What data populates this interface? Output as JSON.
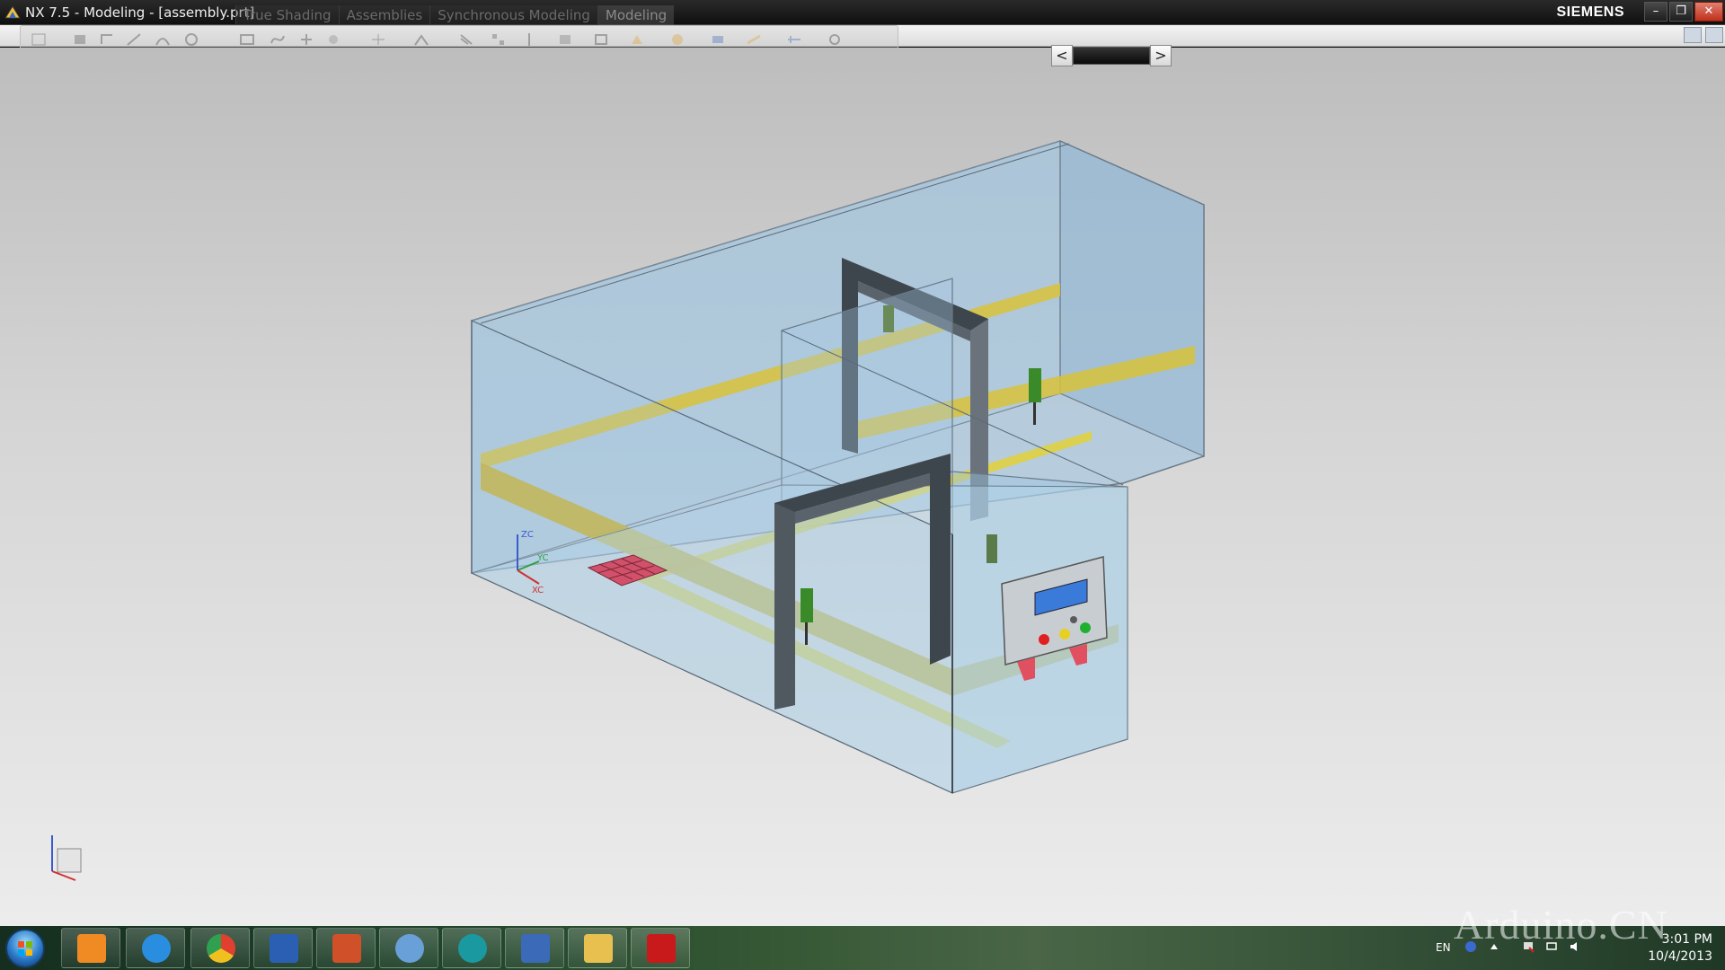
{
  "window": {
    "title": "NX 7.5 - Modeling - [assembly.prt]",
    "brand": "SIEMENS",
    "minimize_label": "–",
    "maximize_label": "❐",
    "close_label": "✕"
  },
  "ribbon": {
    "tabs": [
      {
        "label": "True Shading"
      },
      {
        "label": "Assemblies"
      },
      {
        "label": "Synchronous Modeling"
      },
      {
        "label": "Modeling"
      }
    ]
  },
  "graphics": {
    "background_top": "#bdbdbd",
    "background_bottom": "#ececec",
    "glass_color": "#9cc3e0",
    "rail_color": "#d8c23a",
    "frame_color": "#3e464d",
    "pad_color": "#d2506a",
    "axis_labels": {
      "z": "ZC",
      "y": "YC",
      "x": "XC"
    }
  },
  "scroller": {
    "left_label": "<",
    "right_label": ">"
  },
  "taskbar": {
    "apps": [
      {
        "name": "media-player",
        "color": "#f08a22"
      },
      {
        "name": "internet-explorer",
        "color": "#2a8ee0"
      },
      {
        "name": "chrome",
        "color": "#e04030"
      },
      {
        "name": "word",
        "color": "#2b5fb4"
      },
      {
        "name": "powerpoint",
        "color": "#d0502a"
      },
      {
        "name": "people",
        "color": "#6aa0d8"
      },
      {
        "name": "arduino",
        "color": "#1a9aa0"
      },
      {
        "name": "nx",
        "color": "#3a6ab8"
      },
      {
        "name": "explorer",
        "color": "#e8c050"
      },
      {
        "name": "acrobat",
        "color": "#c81a1a"
      }
    ],
    "language": "EN",
    "time": "3:01 PM",
    "date": "10/4/2013"
  },
  "watermark": "Arduino.CN"
}
